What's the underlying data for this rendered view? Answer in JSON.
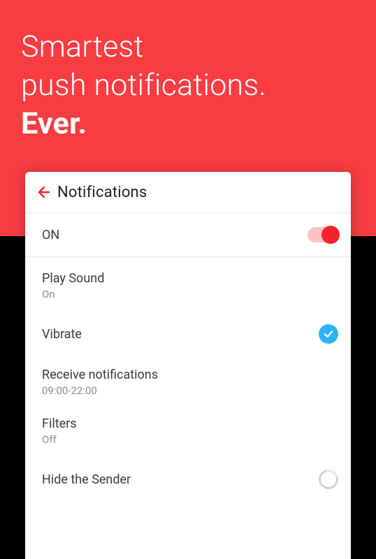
{
  "hero": {
    "line1": "Smartest",
    "line2": "push notifications.",
    "line3": "Ever."
  },
  "header": {
    "title": "Notifications"
  },
  "master_toggle": {
    "label": "ON",
    "state": "on"
  },
  "settings": [
    {
      "title": "Play Sound",
      "subtitle": "On"
    },
    {
      "title": "Vibrate",
      "checked": true
    },
    {
      "title": "Receive notifications",
      "subtitle": "09:00-22:00"
    },
    {
      "title": "Filters",
      "subtitle": "Off"
    },
    {
      "title": "Hide the Sender",
      "loading": true
    }
  ],
  "colors": {
    "accent": "#F5232E",
    "hero_bg": "#F73C42",
    "check": "#29B6F6"
  }
}
